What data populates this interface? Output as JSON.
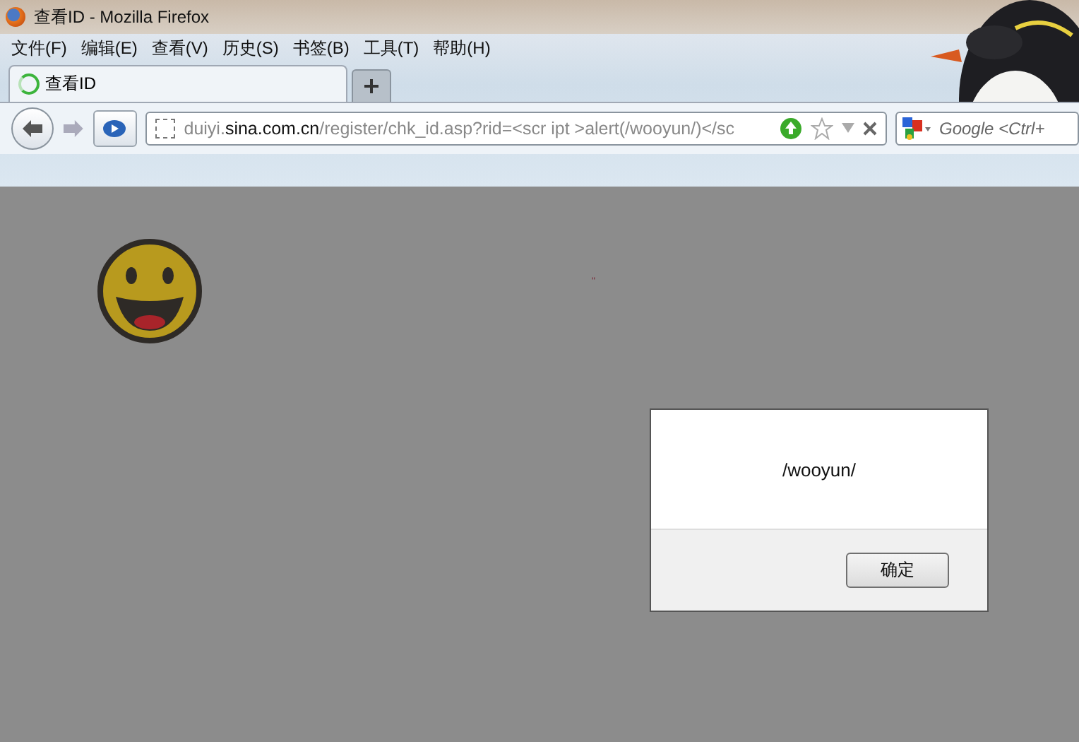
{
  "window": {
    "title": "查看ID - Mozilla Firefox"
  },
  "menu": [
    "文件(F)",
    "编辑(E)",
    "查看(V)",
    "历史(S)",
    "书签(B)",
    "工具(T)",
    "帮助(H)"
  ],
  "tabs": [
    {
      "label": "查看ID",
      "selected": true,
      "loading": true
    }
  ],
  "url": {
    "subdomain": "duiyi.",
    "domain": "sina.com.cn",
    "path": "/register/chk_id.asp?rid=<scr ipt >alert(/wooyun/)</sc"
  },
  "search": {
    "placeholder": "Google <Ctrl+"
  },
  "page": {
    "stray_text": "\""
  },
  "dialog": {
    "message": "/wooyun/",
    "button": "确定"
  }
}
